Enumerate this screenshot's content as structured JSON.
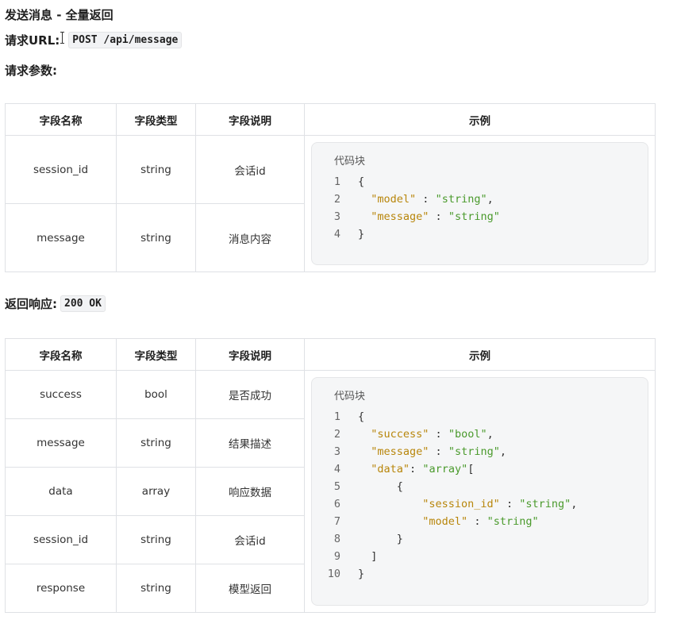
{
  "heading": "发送消息 - 全量返回",
  "request_url_label": "请求URL:",
  "request_url": "POST /api/message",
  "request_params_label": "请求参数:",
  "response_label": "返回响应:",
  "response_code": "200 OK",
  "headers": [
    "字段名称",
    "字段类型",
    "字段说明",
    "示例"
  ],
  "code_block_title": "代码块",
  "request_table": {
    "rows": [
      {
        "name": "session_id",
        "type": "string",
        "desc": "会话id"
      },
      {
        "name": "message",
        "type": "string",
        "desc": "消息内容"
      }
    ],
    "code": [
      {
        "n": "1",
        "parts": [
          {
            "t": "{",
            "c": "p"
          }
        ]
      },
      {
        "n": "2",
        "parts": [
          {
            "t": "  ",
            "c": "p"
          },
          {
            "t": "\"model\"",
            "c": "k"
          },
          {
            "t": " : ",
            "c": "p"
          },
          {
            "t": "\"string\"",
            "c": "s"
          },
          {
            "t": ",",
            "c": "p"
          }
        ]
      },
      {
        "n": "3",
        "parts": [
          {
            "t": "  ",
            "c": "p"
          },
          {
            "t": "\"message\"",
            "c": "k"
          },
          {
            "t": " : ",
            "c": "p"
          },
          {
            "t": "\"string\"",
            "c": "s"
          }
        ]
      },
      {
        "n": "4",
        "parts": [
          {
            "t": "}",
            "c": "p"
          }
        ]
      }
    ]
  },
  "response_table": {
    "rows": [
      {
        "name": "success",
        "type": "bool",
        "desc": "是否成功"
      },
      {
        "name": "message",
        "type": "string",
        "desc": "结果描述"
      },
      {
        "name": "data",
        "type": "array",
        "desc": "响应数据"
      },
      {
        "name": "session_id",
        "type": "string",
        "desc": "会话id"
      },
      {
        "name": "response",
        "type": "string",
        "desc": "模型返回"
      }
    ],
    "code": [
      {
        "n": "1",
        "parts": [
          {
            "t": "{",
            "c": "p"
          }
        ]
      },
      {
        "n": "2",
        "parts": [
          {
            "t": "  ",
            "c": "p"
          },
          {
            "t": "\"success\"",
            "c": "k"
          },
          {
            "t": " : ",
            "c": "p"
          },
          {
            "t": "\"bool\"",
            "c": "s"
          },
          {
            "t": ",",
            "c": "p"
          }
        ]
      },
      {
        "n": "3",
        "parts": [
          {
            "t": "  ",
            "c": "p"
          },
          {
            "t": "\"message\"",
            "c": "k"
          },
          {
            "t": " : ",
            "c": "p"
          },
          {
            "t": "\"string\"",
            "c": "s"
          },
          {
            "t": ",",
            "c": "p"
          }
        ]
      },
      {
        "n": "4",
        "parts": [
          {
            "t": "  ",
            "c": "p"
          },
          {
            "t": "\"data\"",
            "c": "k"
          },
          {
            "t": ": ",
            "c": "p"
          },
          {
            "t": "\"array\"",
            "c": "s"
          },
          {
            "t": "[",
            "c": "p"
          }
        ]
      },
      {
        "n": "5",
        "parts": [
          {
            "t": "      {",
            "c": "p"
          }
        ]
      },
      {
        "n": "6",
        "parts": [
          {
            "t": "          ",
            "c": "p"
          },
          {
            "t": "\"session_id\"",
            "c": "k"
          },
          {
            "t": " : ",
            "c": "p"
          },
          {
            "t": "\"string\"",
            "c": "s"
          },
          {
            "t": ",",
            "c": "p"
          }
        ]
      },
      {
        "n": "7",
        "parts": [
          {
            "t": "          ",
            "c": "p"
          },
          {
            "t": "\"model\"",
            "c": "k"
          },
          {
            "t": " : ",
            "c": "p"
          },
          {
            "t": "\"string\"",
            "c": "s"
          }
        ]
      },
      {
        "n": "8",
        "parts": [
          {
            "t": "      }",
            "c": "p"
          }
        ]
      },
      {
        "n": "9",
        "parts": [
          {
            "t": "  ]",
            "c": "p"
          }
        ]
      },
      {
        "n": "10",
        "parts": [
          {
            "t": "}",
            "c": "p"
          }
        ]
      }
    ]
  },
  "colors": {
    "key": "#b8860b",
    "string": "#4a9a2c",
    "border": "#dfe1e5",
    "code_bg": "#f5f6f7"
  }
}
